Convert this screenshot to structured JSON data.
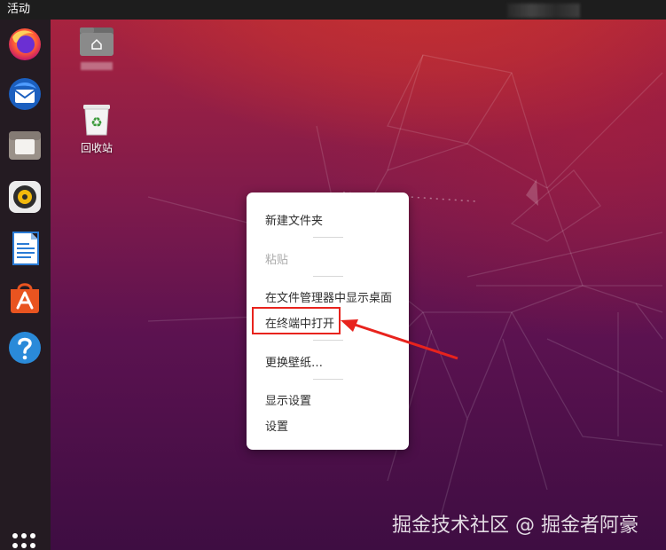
{
  "topbar": {
    "activities_label": "活动"
  },
  "dock": {
    "items": [
      {
        "icon": "firefox-icon"
      },
      {
        "icon": "thunderbird-icon"
      },
      {
        "icon": "files-icon"
      },
      {
        "icon": "rhythmbox-icon"
      },
      {
        "icon": "libreoffice-writer-icon"
      },
      {
        "icon": "ubuntu-software-icon"
      },
      {
        "icon": "help-icon"
      }
    ],
    "apps_icon": "show-applications-icon"
  },
  "desktop": {
    "icons": [
      {
        "name": "home-folder",
        "label": ""
      },
      {
        "name": "trash",
        "label": "回收站"
      }
    ]
  },
  "context_menu": {
    "items": [
      {
        "label": "新建文件夹",
        "enabled": true
      },
      {
        "label": "粘贴",
        "enabled": false
      },
      {
        "label": "在文件管理器中显示桌面",
        "enabled": true
      },
      {
        "label": "在终端中打开",
        "enabled": true,
        "highlighted": true
      },
      {
        "label": "更换壁纸…",
        "enabled": true
      },
      {
        "label": "显示设置",
        "enabled": true
      },
      {
        "label": "设置",
        "enabled": true
      }
    ]
  },
  "annotation": {
    "color": "#e8231d"
  },
  "watermark": "掘金技术社区 @ 掘金者阿豪",
  "colors": {
    "dock_bg": "#241b22",
    "topbar_bg": "#1d1d1d",
    "wallpaper_top": "#c7322f",
    "wallpaper_bottom": "#3e0d42"
  }
}
